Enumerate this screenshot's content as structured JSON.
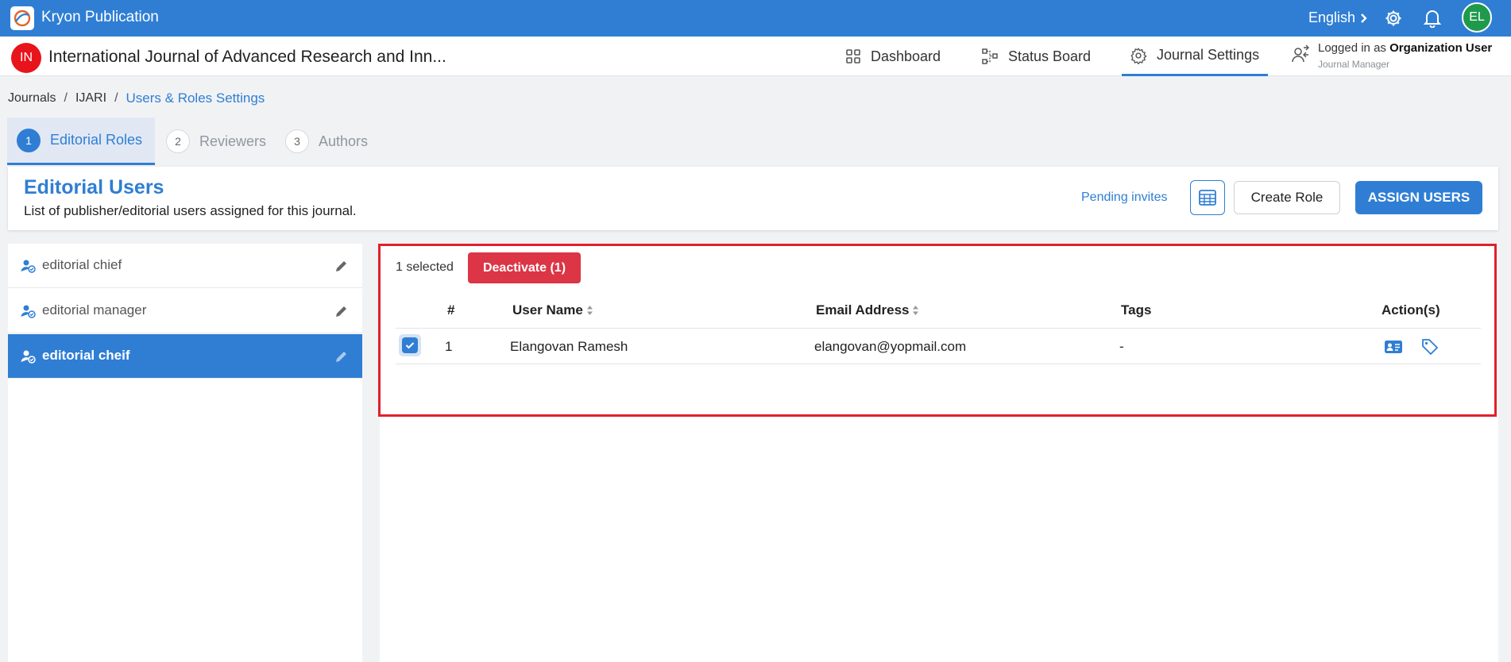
{
  "app": {
    "title": "Kryon Publication",
    "language": "English",
    "avatar_initials": "EL",
    "brand_color": "#2f7ed4"
  },
  "journal": {
    "badge": "IN",
    "title": "International Journal of Advanced Research and Inn...",
    "nav": [
      {
        "label": "Dashboard",
        "icon": "dashboard-icon"
      },
      {
        "label": "Status Board",
        "icon": "status-board-icon"
      },
      {
        "label": "Journal Settings",
        "icon": "gear-icon"
      }
    ],
    "logged_in_prefix": "Logged in as",
    "logged_in_user": "Organization User",
    "logged_in_role": "Journal Manager"
  },
  "breadcrumb": [
    "Journals",
    "IJARI",
    "Users & Roles Settings"
  ],
  "steps": [
    {
      "num": "1",
      "label": "Editorial Roles"
    },
    {
      "num": "2",
      "label": "Reviewers"
    },
    {
      "num": "3",
      "label": "Authors"
    }
  ],
  "section": {
    "title": "Editorial Users",
    "subtitle": "List of publisher/editorial users assigned for this journal.",
    "pending_invites": "Pending invites",
    "create_role": "Create Role",
    "assign_users": "ASSIGN USERS"
  },
  "roles": [
    {
      "label": "editorial chief"
    },
    {
      "label": "editorial manager"
    },
    {
      "label": "editorial cheif"
    }
  ],
  "table": {
    "selected_text": "1 selected",
    "deactivate_label": "Deactivate (1)",
    "headers": {
      "num": "#",
      "user_name": "User Name",
      "email": "Email Address",
      "tags": "Tags",
      "actions": "Action(s)"
    },
    "rows": [
      {
        "num": "1",
        "user_name": "Elangovan Ramesh",
        "email": "elangovan@yopmail.com",
        "tags": "-",
        "checked": true
      }
    ]
  },
  "colors": {
    "danger": "#dc3545",
    "highlight_border": "#e0202c",
    "journal_badge": "#e8141b",
    "avatar": "#1f9a4c"
  }
}
